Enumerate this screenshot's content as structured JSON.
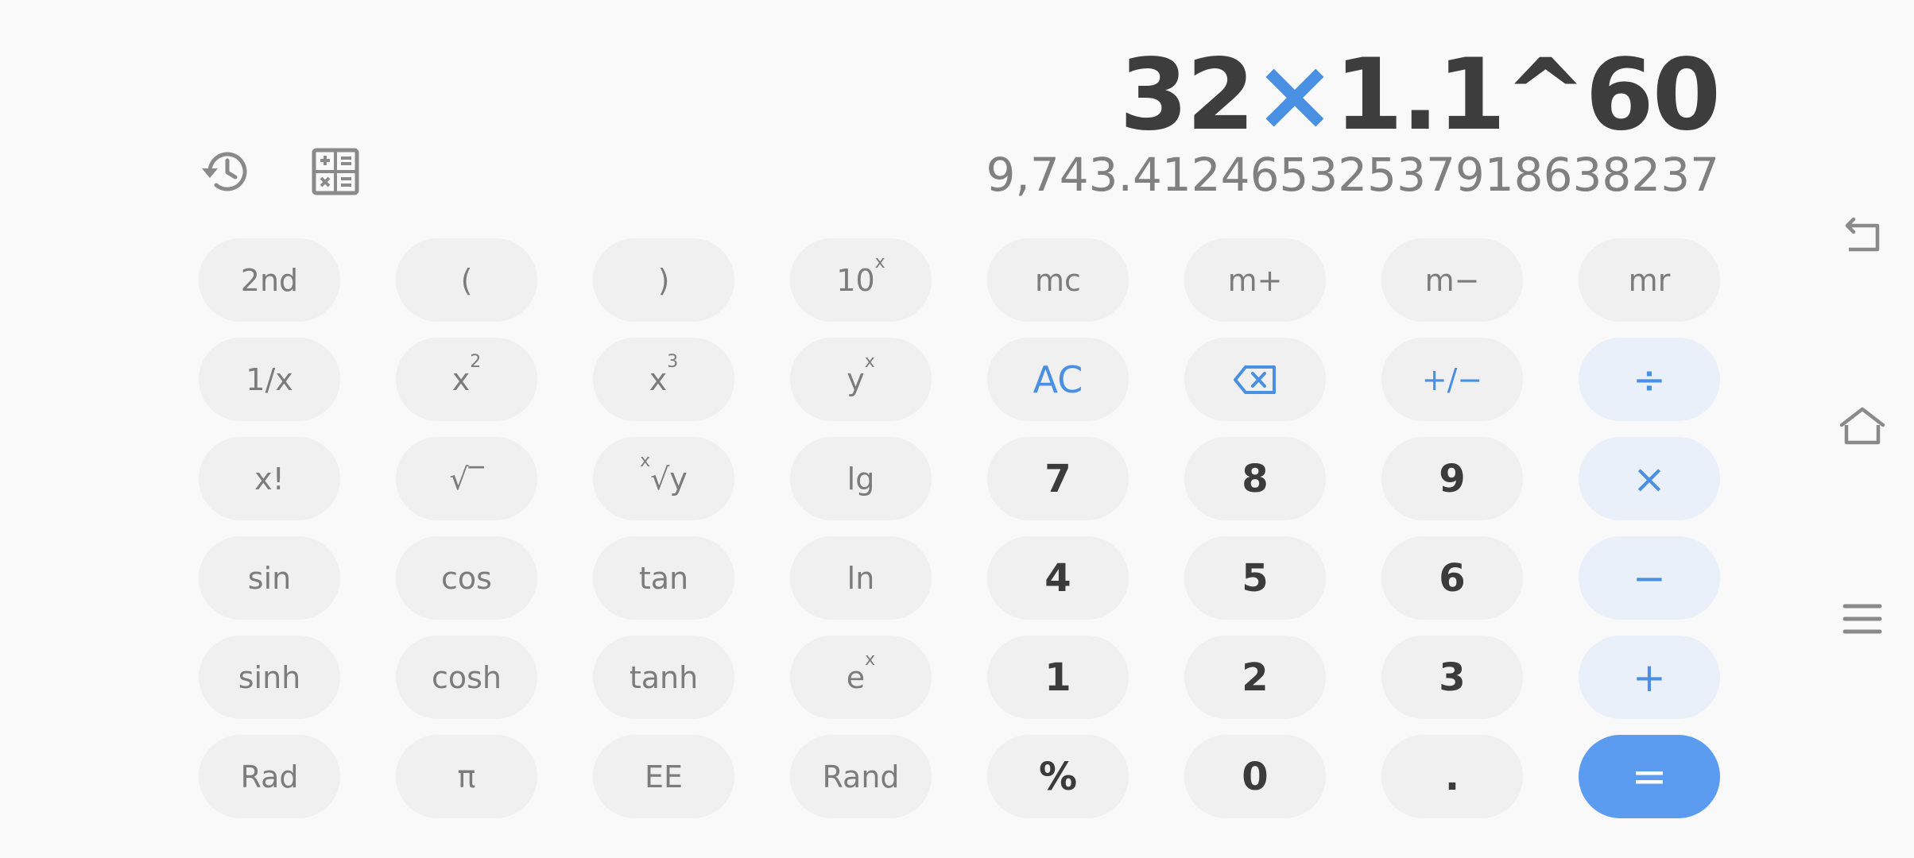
{
  "display": {
    "expression_a": "32",
    "expression_op": "×",
    "expression_b": "1.1^60",
    "result": "9,743.4124653253791863823 7"
  },
  "toolbar": {
    "history_icon": "history-icon",
    "mode_icon": "calculator-mode-icon"
  },
  "keys": {
    "row1": [
      "2nd",
      "(",
      ")",
      "10",
      "mc",
      "m+",
      "m−",
      "mr"
    ],
    "row1_sup": {
      "k4": "x"
    },
    "row2": [
      "1/x",
      "x",
      "x",
      "y",
      "AC",
      "",
      "+/−",
      "÷"
    ],
    "row2_sup": {
      "k2": "2",
      "k3": "3",
      "k4": "x"
    },
    "row3": [
      "x!",
      "√‾",
      "√y",
      "lg",
      "7",
      "8",
      "9",
      "×"
    ],
    "row3_pre": {
      "k3": "x"
    },
    "row4": [
      "sin",
      "cos",
      "tan",
      "ln",
      "4",
      "5",
      "6",
      "−"
    ],
    "row5": [
      "sinh",
      "cosh",
      "tanh",
      "e",
      "1",
      "2",
      "3",
      "+"
    ],
    "row5_sup": {
      "k4": "x"
    },
    "row6": [
      "Rad",
      "π",
      "EE",
      "Rand",
      "%",
      "0",
      ".",
      "="
    ]
  },
  "colors": {
    "accent": "#4a90e2",
    "equals_bg": "#5b9cf0",
    "operator_bg": "#e9f0fa",
    "key_bg": "#f0f0f0"
  },
  "nav": {
    "back_icon": "back-icon",
    "home_icon": "home-icon",
    "menu_icon": "menu-icon"
  }
}
